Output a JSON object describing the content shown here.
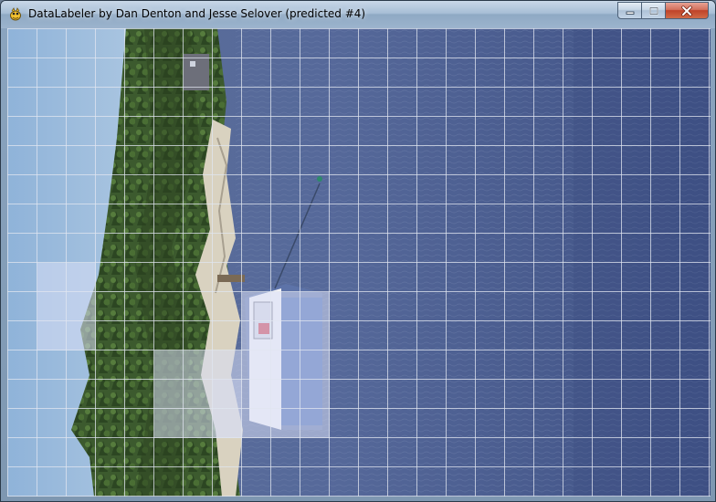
{
  "window": {
    "title": "DataLabeler by Dan Denton and Jesse Selover (predicted #4)",
    "app_icon": "pygame-snake-icon",
    "controls": {
      "minimize_icon": "minimize-icon",
      "maximize_icon": "maximize-icon",
      "close_icon": "close-icon"
    }
  },
  "canvas": {
    "image_description_icon": "photo-canvas",
    "grid_color": "#e1e6f0",
    "selection_color": "#d8def5"
  }
}
